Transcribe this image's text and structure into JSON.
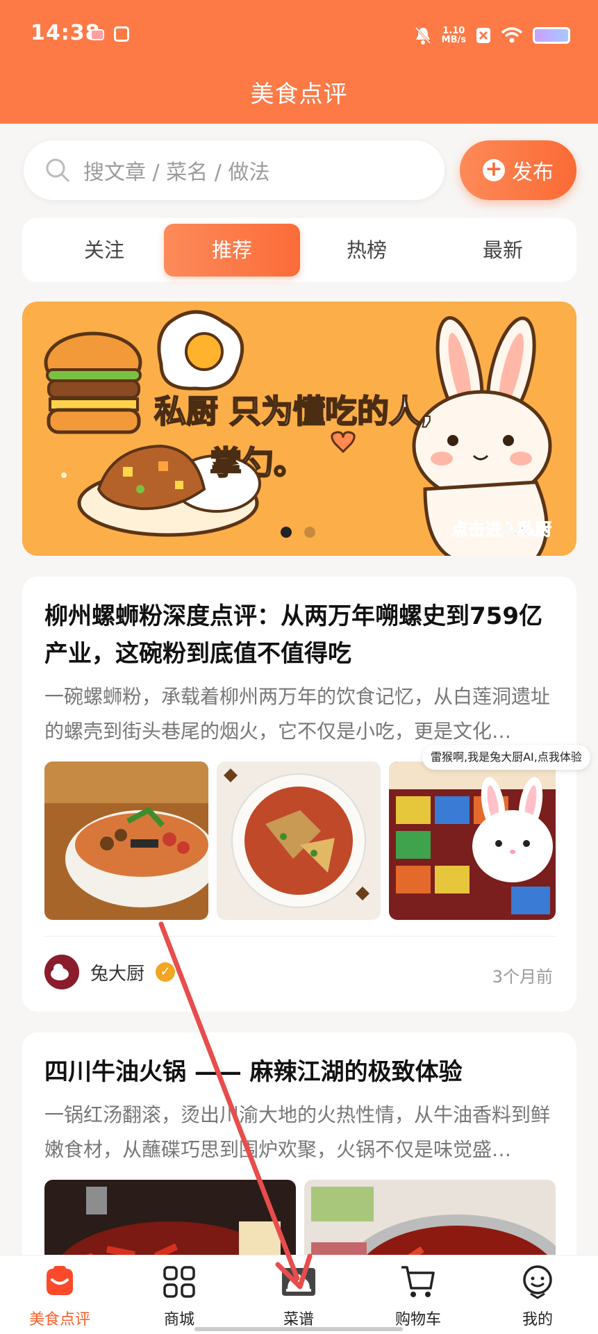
{
  "status": {
    "time": "14:38",
    "speed_top": "1.10",
    "speed_bottom": "MB/s"
  },
  "header": {
    "title": "美食点评"
  },
  "search": {
    "placeholder": "搜文章 / 菜名 / 做法"
  },
  "publish": {
    "label": "发布"
  },
  "tabs": [
    {
      "label": "关注"
    },
    {
      "label": "推荐"
    },
    {
      "label": "热榜"
    },
    {
      "label": "最新"
    }
  ],
  "banner": {
    "line1": "私厨 只为懂吃的人,",
    "line2": "掌勺。",
    "cta": "点击进入私厨",
    "slide_count": 2,
    "active_slide": 1
  },
  "articles": [
    {
      "title": "柳州螺蛳粉深度点评：从两万年嗍螺史到759亿产业，这碗粉到底值不值得吃",
      "desc": "一碗螺蛳粉，承载着柳州两万年的饮食记忆，从白莲洞遗址的螺壳到街头巷尾的烟火，它不仅是小吃，更是文化…",
      "author": "兔大厨",
      "time": "3个月前"
    },
    {
      "title": "四川牛油火锅 —— 麻辣江湖的极致体验",
      "desc": "一锅红汤翻滚，烫出川渝大地的火热性情，从牛油香料到鲜嫩食材，从蘸碟巧思到围炉欢聚，火锅不仅是味觉盛…"
    }
  ],
  "assistant": {
    "tooltip": "雷猴啊,我是兔大厨AI,点我体验"
  },
  "tabbar": [
    {
      "label": "美食点评"
    },
    {
      "label": "商城"
    },
    {
      "label": "菜谱"
    },
    {
      "label": "购物车"
    },
    {
      "label": "我的"
    }
  ],
  "colors": {
    "brand": "#fd7a46",
    "active_tab": "#fb6c39",
    "banner_bg": "#fcae49",
    "annotation_arrow": "#e84c4c"
  }
}
